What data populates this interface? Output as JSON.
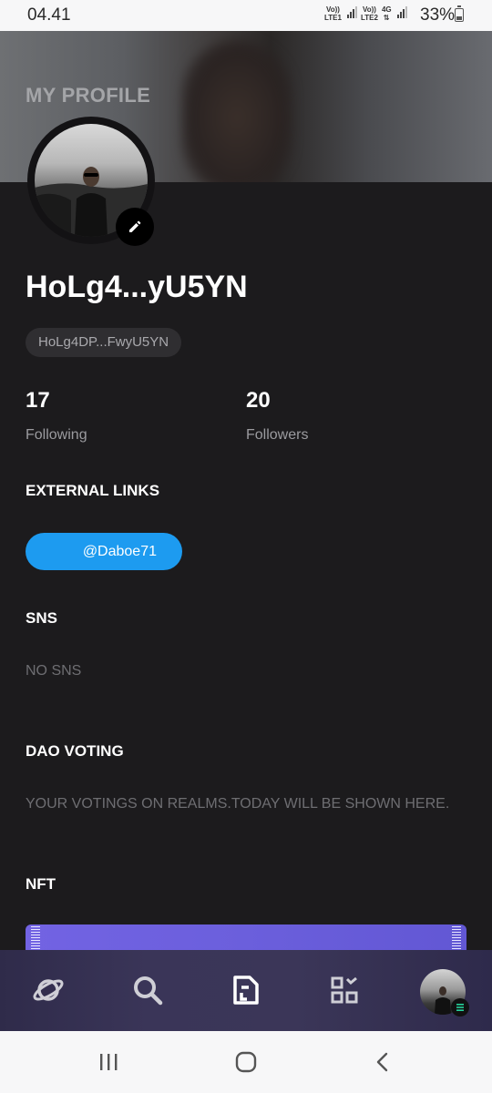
{
  "status_bar": {
    "time": "04.41",
    "sim1_top": "Vo))",
    "sim1_bottom": "LTE1",
    "sim2_top": "Vo))",
    "sim2_bottom": "LTE2",
    "network": "4G",
    "battery": "33%",
    "battery_level": 0.33
  },
  "header": {
    "title": "MY PROFILE"
  },
  "profile": {
    "name": "HoLg4...yU5YN",
    "address": "HoLg4DP...FwyU5YN"
  },
  "stats": {
    "following_count": "17",
    "following_label": "Following",
    "followers_count": "20",
    "followers_label": "Followers"
  },
  "external_links": {
    "title": "EXTERNAL LINKS",
    "twitter_handle": "@Daboe71"
  },
  "sns": {
    "title": "SNS",
    "empty_text": "NO SNS"
  },
  "dao_voting": {
    "title": "DAO VOTING",
    "empty_text": "YOUR VOTINGS ON REALMS.TODAY WILL BE SHOWN HERE."
  },
  "nft": {
    "title": "NFT"
  },
  "bottom_nav": {
    "items": [
      {
        "icon": "planet-icon",
        "active": false
      },
      {
        "icon": "search-icon",
        "active": false
      },
      {
        "icon": "document-edit-icon",
        "active": true
      },
      {
        "icon": "qr-scan-icon",
        "active": false
      },
      {
        "icon": "profile-avatar",
        "active": false
      }
    ]
  },
  "colors": {
    "background": "#1c1b1d",
    "twitter_blue": "#1d9bf0",
    "nft_purple": "#6b5fdc",
    "muted_text": "#6e6e72"
  }
}
